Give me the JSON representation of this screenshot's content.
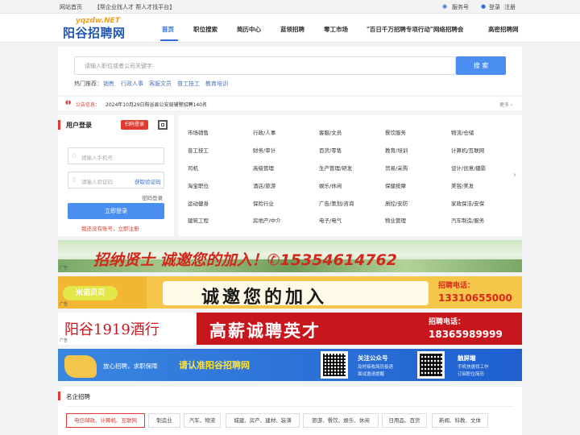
{
  "topbar": {
    "home": "网站首页",
    "slogan": "【帮企业找人才 帮人才找平台】",
    "service": "服务号",
    "login": "登录",
    "register": "注册"
  },
  "logo": {
    "domain": "yqzdw.NET",
    "name": "阳谷招聘网"
  },
  "nav": [
    "首页",
    "职位搜索",
    "简历中心",
    "蓝领招聘",
    "零工市场",
    "\"百日千万招聘专项行动\"网络招聘会",
    "高密招聘网"
  ],
  "search": {
    "placeholder": "请输入职位或者公司关键字",
    "button": "搜 索",
    "hot_label": "热门推荐：",
    "hot": [
      "销售",
      "行政人事",
      "客服文员",
      "普工技工",
      "教育培训"
    ]
  },
  "notice": {
    "label": "公告信息：",
    "text": "2024年10月29日阳谷县公安局辅警招聘140名",
    "more": "更多 ›"
  },
  "login": {
    "title": "用户登录",
    "scan": "扫码登录",
    "phone_placeholder": "请输入手机号",
    "code_placeholder": "请输入验证码",
    "get_code": "获取验证码",
    "pwd_login": "密码登录",
    "submit": "立即登录",
    "register": "我还没有账号，立即注册"
  },
  "categories": [
    [
      "市场销售",
      "行政/人事",
      "客服/文员",
      "餐饮服务",
      "物流/仓储"
    ],
    [
      "普工技工",
      "财务/审计",
      "百货/零售",
      "教育/培训",
      "计算机/互联网"
    ],
    [
      "司机",
      "高级管理",
      "生产管理/研发",
      "贸易/采购",
      "设计/创意/摄影"
    ],
    [
      "淘宝职位",
      "酒店/旅游",
      "娱乐/休闲",
      "保健按摩",
      "美容/美发"
    ],
    [
      "运动健身",
      "保险行业",
      "广告/策划/咨询",
      "质控/安防",
      "家政保洁/安保"
    ],
    [
      "建筑工程",
      "房地产/中介",
      "电子/电气",
      "物业管理",
      "汽车制造/服务"
    ]
  ],
  "ads": {
    "ad1": "招纳贤士 诚邀您的加入！✆15354614762",
    "ad2_brand": "米诺贝贝",
    "ad2_main": "诚邀您的加入",
    "ad2_label": "招聘电话：",
    "ad2_phone": "13310655000",
    "ad3_brand": "阳谷1919酒行",
    "ad3_main": "高薪诚聘英才",
    "ad3_label": "招聘电话：",
    "ad3_phone": "18365989999",
    "ad4_left": "放心招聘，求职保障",
    "ad4_main": "请认准阳谷招聘网",
    "ad4_follow": "关注公众号",
    "ad4_follow_sub1": "及时接收简历投递",
    "ad4_follow_sub2": "面试邀请提醒",
    "ad4_touch": "触屏端",
    "ad4_touch_sub1": "手机快速找工作",
    "ad4_touch_sub2": "订阅职位简历",
    "ad_tag": "广告"
  },
  "famous": {
    "title": "名企招聘",
    "tags": [
      "电信邮政、计算机、互联网",
      "制造业",
      "汽车、物流",
      "城建、房产、建材、装潢",
      "旅游、餐饮、娱乐、休闲",
      "日用品、百货",
      "新闻、科教、文体"
    ]
  },
  "colors": {
    "accent": "#2f6fd6",
    "button": "#4a8ff0",
    "red": "#e03b2f"
  }
}
